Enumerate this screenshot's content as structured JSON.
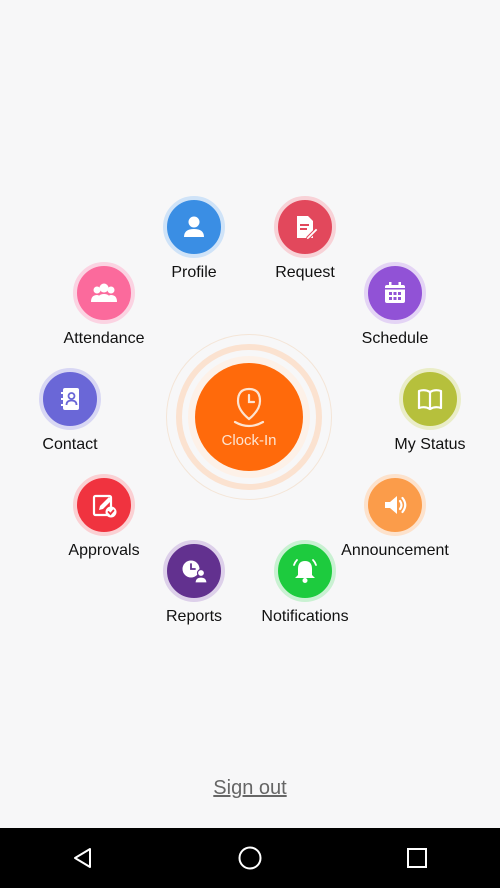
{
  "menu": {
    "profile": {
      "label": "Profile",
      "color": "#3a8ee4",
      "ring": "#cfe3f8",
      "icon": "person-icon"
    },
    "request": {
      "label": "Request",
      "color": "#e2485c",
      "ring": "#f8d2d7",
      "icon": "document-edit-icon"
    },
    "attendance": {
      "label": "Attendance",
      "color": "#fb6a9c",
      "ring": "#fbd3e2",
      "icon": "group-icon"
    },
    "schedule": {
      "label": "Schedule",
      "color": "#9152d6",
      "ring": "#e4d4f5",
      "icon": "calendar-icon"
    },
    "contact": {
      "label": "Contact",
      "color": "#6a67d7",
      "ring": "#d8d7f4",
      "icon": "contact-book-icon"
    },
    "my_status": {
      "label": "My Status",
      "color": "#b6c03c",
      "ring": "#eaedc8",
      "icon": "book-icon"
    },
    "approvals": {
      "label": "Approvals",
      "color": "#f0333f",
      "ring": "#fbd0d3",
      "icon": "approval-icon"
    },
    "announcement": {
      "label": "Announcement",
      "color": "#fb9c4a",
      "ring": "#fde2cc",
      "icon": "speaker-icon"
    },
    "reports": {
      "label": "Reports",
      "color": "#62318f",
      "ring": "#ddd0ea",
      "icon": "reports-icon"
    },
    "notifications": {
      "label": "Notifications",
      "color": "#1dcb3e",
      "ring": "#c9f1d2",
      "icon": "bell-icon"
    }
  },
  "clock_in": {
    "label": "Clock-In",
    "color": "#ff6a0b",
    "icon": "location-clock-icon"
  },
  "sign_out": {
    "label": "Sign out"
  },
  "navbar": {
    "back": "back-icon",
    "home": "home-icon",
    "recents": "recents-icon"
  }
}
